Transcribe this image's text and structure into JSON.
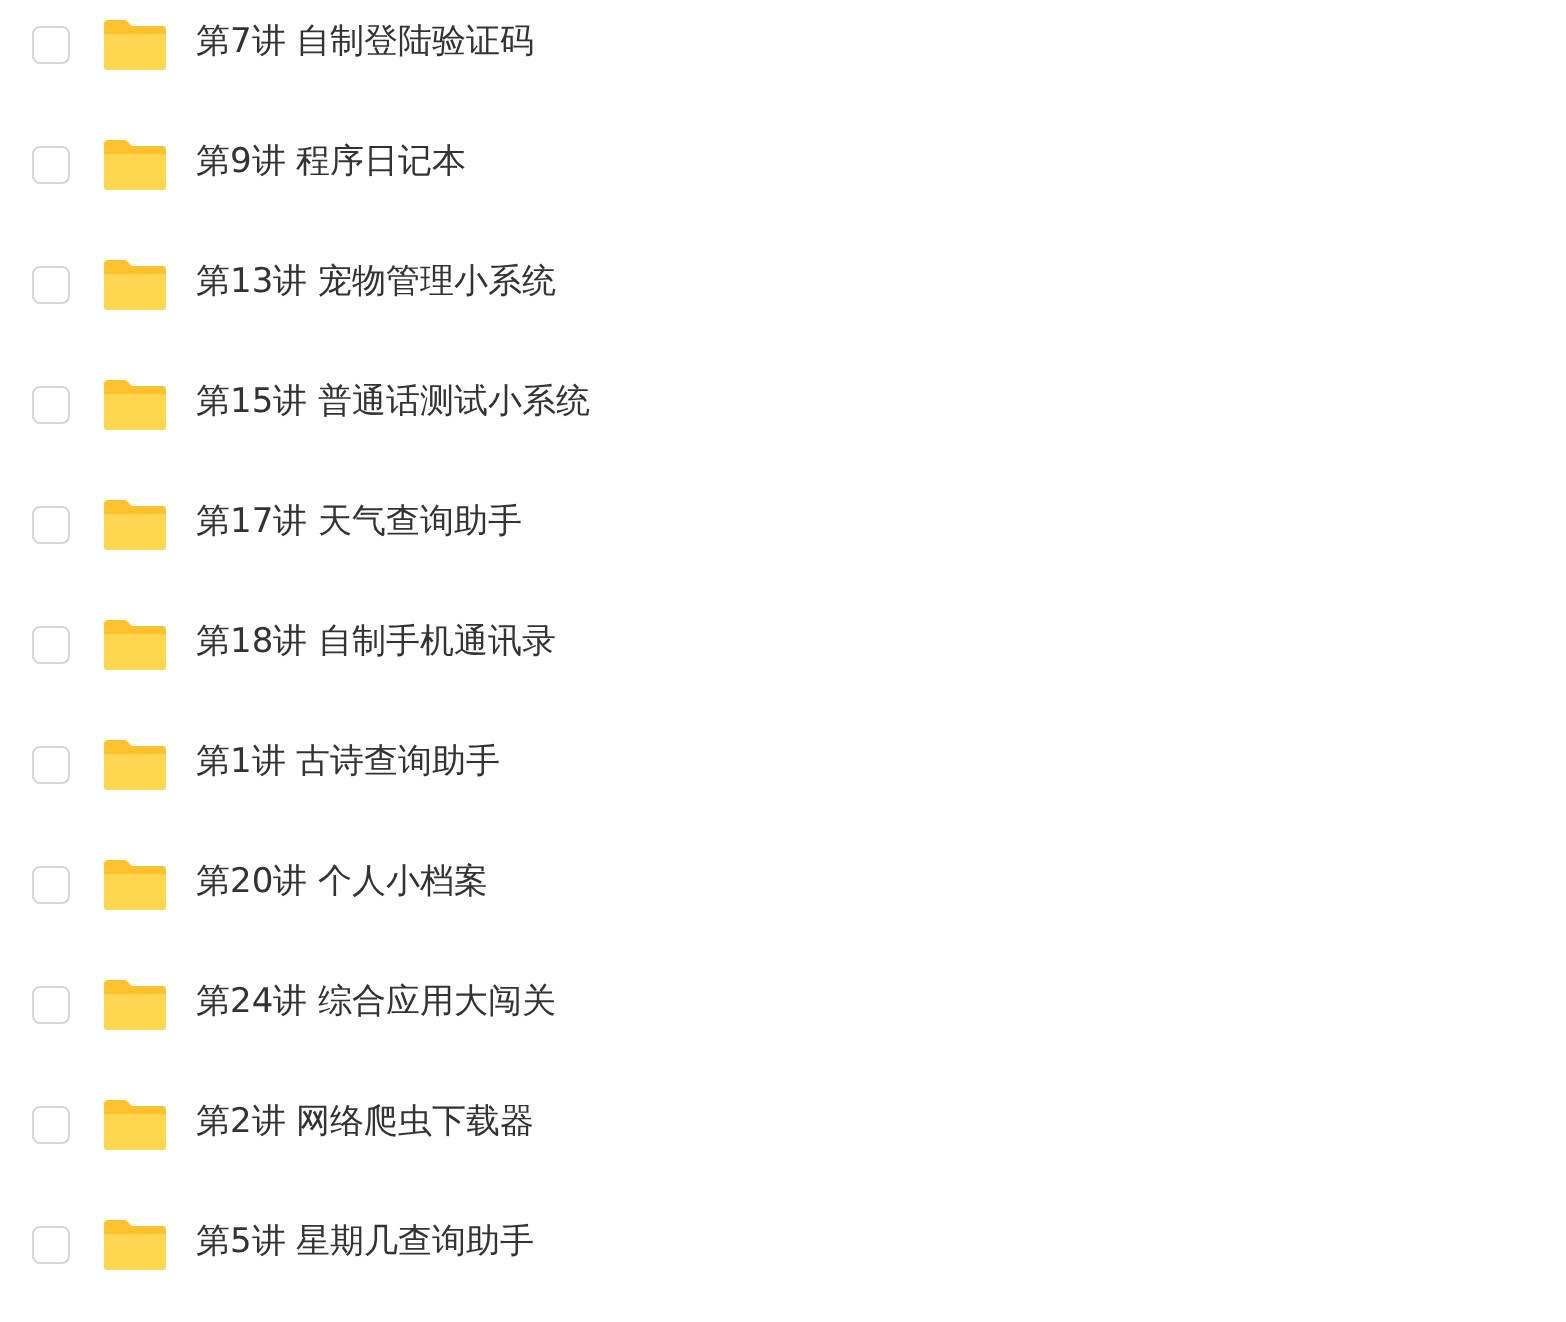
{
  "files": [
    {
      "name": "第7讲 自制登陆验证码",
      "checked": false
    },
    {
      "name": "第9讲 程序日记本",
      "checked": false
    },
    {
      "name": "第13讲 宠物管理小系统",
      "checked": false
    },
    {
      "name": "第15讲 普通话测试小系统",
      "checked": false
    },
    {
      "name": "第17讲 天气查询助手",
      "checked": false
    },
    {
      "name": "第18讲 自制手机通讯录",
      "checked": false
    },
    {
      "name": "第1讲 古诗查询助手",
      "checked": false
    },
    {
      "name": "第20讲 个人小档案",
      "checked": false
    },
    {
      "name": "第24讲 综合应用大闯关",
      "checked": false
    },
    {
      "name": "第2讲 网络爬虫下载器",
      "checked": false
    },
    {
      "name": "第5讲 星期几查询助手",
      "checked": false
    }
  ]
}
